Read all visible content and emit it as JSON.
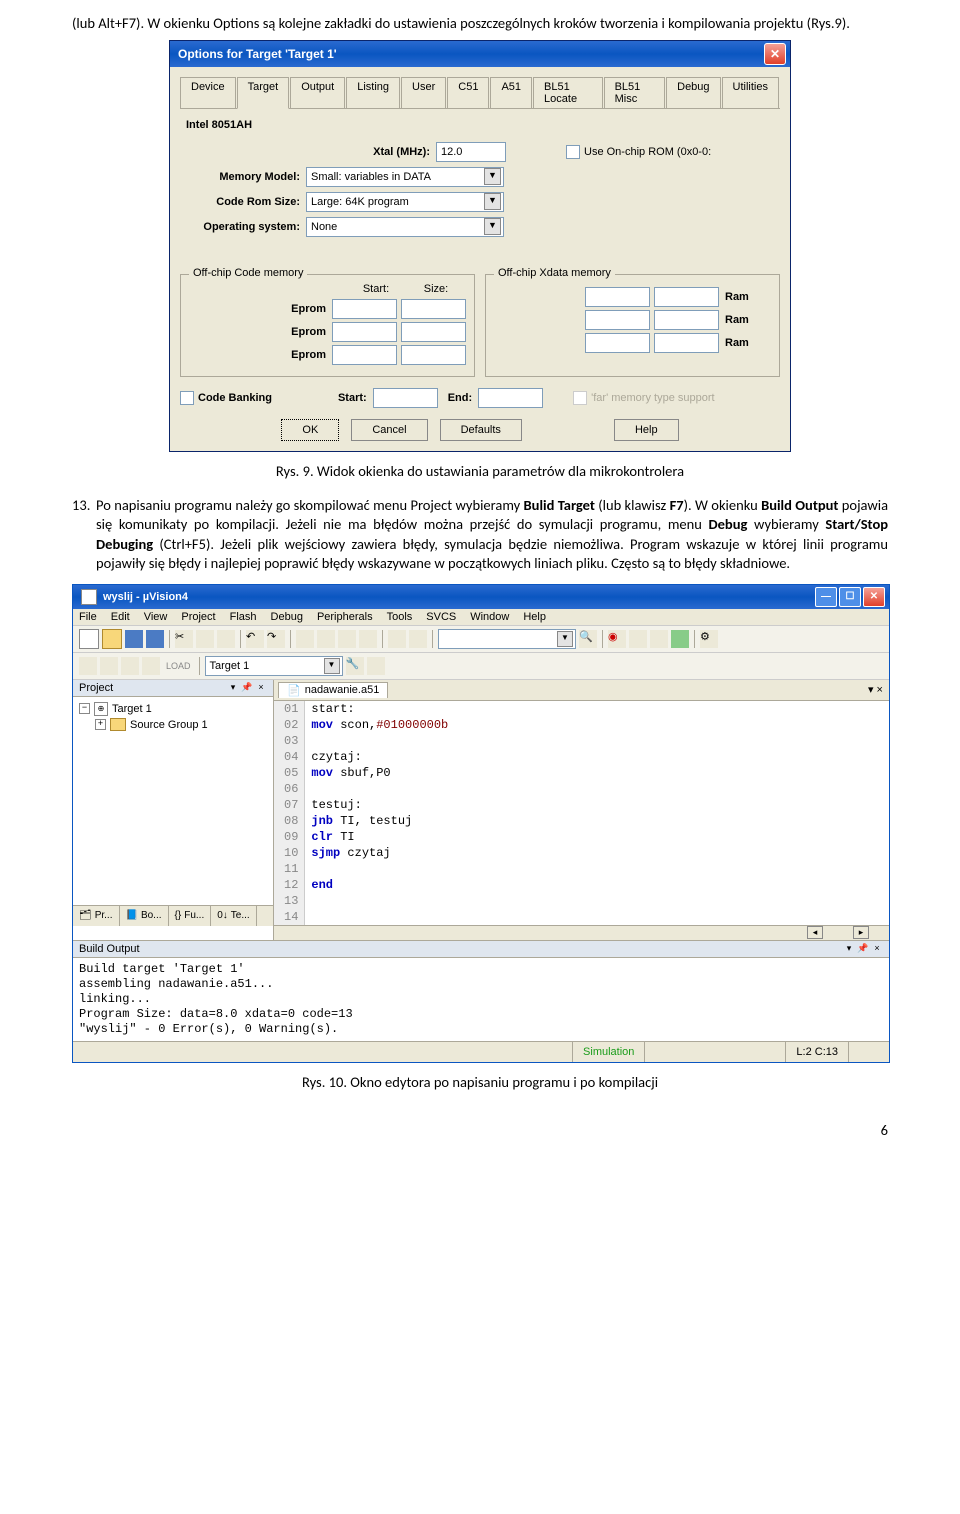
{
  "intro_para": "(lub Alt+F7). W okienku Options są kolejne zakładki do ustawienia poszczególnych kroków tworzenia i kompilowania projektu (Rys.9).",
  "caption1": "Rys. 9. Widok okienka do ustawiania parametrów dla mikrokontrolera",
  "caption2": "Rys. 10. Okno edytora po napisaniu programu i po kompilacji",
  "page_number": "6",
  "list_number": "13.",
  "list_text_1": "Po napisaniu programu należy go skompilować menu Project wybieramy ",
  "list_text_2": "Bulid Target",
  "list_text_3": " (lub klawisz ",
  "list_text_4": "F7",
  "list_text_5": "). W okienku ",
  "list_text_6": "Build Output",
  "list_text_7": " pojawia się komunikaty po kompilacji. Jeżeli nie ma błędów można przejść do symulacji programu, menu ",
  "list_text_8": "Debug",
  "list_text_9": " wybieramy ",
  "list_text_10": "Start/Stop Debuging",
  "list_text_11": "  (Ctrl+F5). Jeżeli plik wejściowy zawiera błędy, symulacja będzie niemożliwa. Program wskazuje w której linii  programu pojawiły się błędy i  najlepiej poprawić błędy wskazywane w początkowych liniach pliku. Często są to błędy składniowe.",
  "dlg": {
    "title": "Options for Target 'Target 1'",
    "tabs": [
      "Device",
      "Target",
      "Output",
      "Listing",
      "User",
      "C51",
      "A51",
      "BL51 Locate",
      "BL51 Misc",
      "Debug",
      "Utilities"
    ],
    "device": "Intel 8051AH",
    "xtal_label": "Xtal (MHz):",
    "xtal_value": "12.0",
    "use_onchip": "Use On-chip ROM (0x0-0:",
    "mem_model_label": "Memory Model:",
    "mem_model_value": "Small: variables in DATA",
    "code_rom_label": "Code Rom Size:",
    "code_rom_value": "Large: 64K program",
    "os_label": "Operating system:",
    "os_value": "None",
    "off_code": "Off-chip Code memory",
    "off_xdata": "Off-chip Xdata memory",
    "hdr_start": "Start:",
    "hdr_size": "Size:",
    "hdr_end": "End:",
    "eprom": "Eprom",
    "ram": "Ram",
    "code_banking": "Code Banking",
    "far_support": "'far' memory type support",
    "ok": "OK",
    "cancel": "Cancel",
    "defaults": "Defaults",
    "help": "Help"
  },
  "ide": {
    "title": "wyslij  - µVision4",
    "menus": [
      "File",
      "Edit",
      "View",
      "Project",
      "Flash",
      "Debug",
      "Peripherals",
      "Tools",
      "SVCS",
      "Window",
      "Help"
    ],
    "target_combo": "Target 1",
    "project_hdr": "Project",
    "tree_target": "Target 1",
    "tree_group": "Source Group 1",
    "proj_tabs": [
      "Pr...",
      "Bo...",
      "Fu...",
      "Te..."
    ],
    "editor_tab": "nadawanie.a51",
    "code_lines": [
      {
        "n": "01",
        "t": "start:",
        "cls": ""
      },
      {
        "n": "02",
        "t": "mov scon,#01000000b",
        "cls": "kw",
        "num": true
      },
      {
        "n": "03",
        "t": "",
        "cls": ""
      },
      {
        "n": "04",
        "t": "czytaj:",
        "cls": ""
      },
      {
        "n": "05",
        "t": "mov sbuf,P0",
        "cls": "kw"
      },
      {
        "n": "06",
        "t": "",
        "cls": ""
      },
      {
        "n": "07",
        "t": "testuj:",
        "cls": ""
      },
      {
        "n": "08",
        "t": "jnb TI, testuj",
        "cls": "kw"
      },
      {
        "n": "09",
        "t": "clr TI",
        "cls": "kw"
      },
      {
        "n": "10",
        "t": "sjmp czytaj",
        "cls": "kw"
      },
      {
        "n": "11",
        "t": "",
        "cls": ""
      },
      {
        "n": "12",
        "t": "end",
        "cls": "kw"
      },
      {
        "n": "13",
        "t": "",
        "cls": ""
      },
      {
        "n": "14",
        "t": "",
        "cls": ""
      }
    ],
    "build_hdr": "Build Output",
    "build_lines": [
      "Build target 'Target 1'",
      "assembling nadawanie.a51...",
      "linking...",
      "Program Size: data=8.0 xdata=0 code=13",
      "\"wyslij\" - 0 Error(s), 0 Warning(s)."
    ],
    "status_sim": "Simulation",
    "status_pos": "L:2 C:13"
  }
}
